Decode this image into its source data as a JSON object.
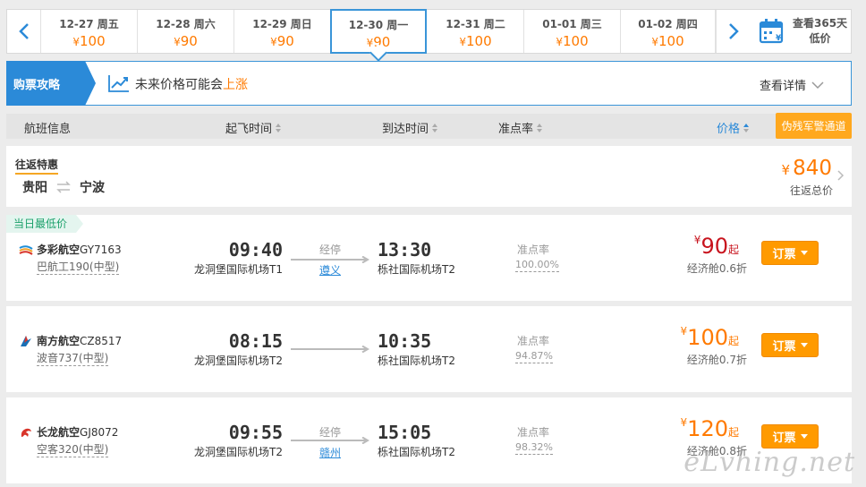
{
  "dates": [
    {
      "date": "12-27 周五",
      "price": "100"
    },
    {
      "date": "12-28 周六",
      "price": "90"
    },
    {
      "date": "12-29 周日",
      "price": "90"
    },
    {
      "date": "12-30 周一",
      "price": "90",
      "active": true
    },
    {
      "date": "12-31 周二",
      "price": "100"
    },
    {
      "date": "01-01 周三",
      "price": "100"
    },
    {
      "date": "01-02 周四",
      "price": "100"
    }
  ],
  "currency": "¥",
  "calendar": {
    "line1": "查看365天",
    "line2": "低价"
  },
  "tips": {
    "tag": "购票攻略",
    "text": "未来价格可能会",
    "trend": "上涨",
    "more": "查看详情"
  },
  "header": {
    "flight_info": "航班信息",
    "dep_time": "起飞时间",
    "arr_time": "到达时间",
    "on_time": "准点率",
    "price": "价格",
    "warning": "伪残军警通道"
  },
  "round_trip": {
    "title": "往返特惠",
    "from": "贵阳",
    "to": "宁波",
    "price": "840",
    "sub": "往返总价"
  },
  "flights": [
    {
      "badge": "当日最低价",
      "airline": "多彩航空",
      "flight_no": "GY7163",
      "plane": "巴航工190(中型)",
      "dep_time": "09:40",
      "dep_airport": "龙洞堡国际机场T1",
      "stop_label": "经停",
      "stop_city": "遵义",
      "arr_time": "13:30",
      "arr_airport": "栎社国际机场T2",
      "on_time_label": "准点率",
      "on_time": "100.00%",
      "price": "90",
      "price_suffix": "起",
      "cabin": "经济舱0.6折",
      "book": "订票"
    },
    {
      "airline": "南方航空",
      "flight_no": "CZ8517",
      "plane": "波音737(中型)",
      "dep_time": "08:15",
      "dep_airport": "龙洞堡国际机场T2",
      "arr_time": "10:35",
      "arr_airport": "栎社国际机场T2",
      "on_time_label": "准点率",
      "on_time": "94.87%",
      "price": "100",
      "price_suffix": "起",
      "cabin": "经济舱0.7折",
      "book": "订票"
    },
    {
      "airline": "长龙航空",
      "flight_no": "GJ8072",
      "plane": "空客320(中型)",
      "dep_time": "09:55",
      "dep_airport": "龙洞堡国际机场T2",
      "stop_label": "经停",
      "stop_city": "赣州",
      "arr_time": "15:05",
      "arr_airport": "栎社国际机场T2",
      "on_time_label": "准点率",
      "on_time": "98.32%",
      "price": "120",
      "price_suffix": "起",
      "cabin": "经济舱0.8折",
      "book": "订票"
    }
  ],
  "watermark": "eLvhing.net",
  "colors": {
    "accent": "#2b8ad8",
    "price": "#ff7a00",
    "low_price": "#c8141e",
    "button": "#ff9a00"
  },
  "icons": {
    "prev": "chevron-left-icon",
    "next": "chevron-right-icon",
    "calendar": "calendar-icon",
    "trend": "trend-up-icon",
    "swap": "swap-icon"
  }
}
